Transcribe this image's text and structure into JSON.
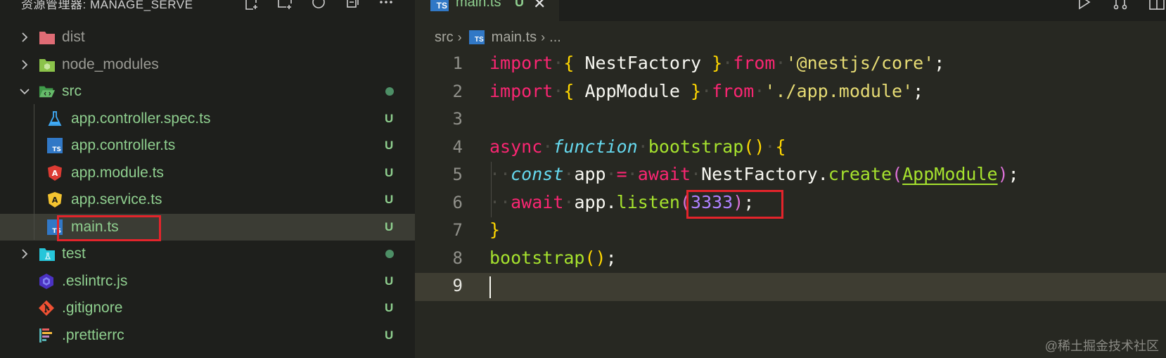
{
  "explorer": {
    "title": "资源管理器: MANAGE_SERVE",
    "actions": [
      "new-file-icon",
      "new-folder-icon",
      "refresh-icon",
      "collapse-all-icon",
      "more-icon"
    ]
  },
  "tree": [
    {
      "name": "dist",
      "type": "folder",
      "expanded": false,
      "color": "#e06c75",
      "label_color": "#9b9b95",
      "status": ""
    },
    {
      "name": "node_modules",
      "type": "folder",
      "expanded": false,
      "color": "#8bc34a",
      "label_color": "#9b9b95",
      "status": ""
    },
    {
      "name": "src",
      "type": "folder",
      "expanded": true,
      "color": "#4caf50",
      "label_color": "#8fcf8f",
      "status": "dot"
    },
    {
      "name": "app.controller.spec.ts",
      "type": "file",
      "icon": "flask-icon",
      "label_color": "#8fcf8f",
      "status": "U"
    },
    {
      "name": "app.controller.ts",
      "type": "file",
      "icon": "typescript-icon",
      "label_color": "#8fcf8f",
      "status": "U"
    },
    {
      "name": "app.module.ts",
      "type": "file",
      "icon": "angular-icon",
      "label_color": "#8fcf8f",
      "status": "U"
    },
    {
      "name": "app.service.ts",
      "type": "file",
      "icon": "angular-service-icon",
      "label_color": "#8fcf8f",
      "status": "U"
    },
    {
      "name": "main.ts",
      "type": "file",
      "icon": "typescript-icon",
      "label_color": "#8fcf8f",
      "status": "U",
      "selected": true
    },
    {
      "name": "test",
      "type": "folder",
      "expanded": false,
      "color": "#26c6da",
      "label_color": "#8fcf8f",
      "status": "dot"
    },
    {
      "name": ".eslintrc.js",
      "type": "file",
      "icon": "eslint-icon",
      "label_color": "#8fcf8f",
      "status": "U"
    },
    {
      "name": ".gitignore",
      "type": "file",
      "icon": "git-icon",
      "label_color": "#8fcf8f",
      "status": "U"
    },
    {
      "name": ".prettierrc",
      "type": "file",
      "icon": "prettier-icon",
      "label_color": "#8fcf8f",
      "status": "U"
    }
  ],
  "tab": {
    "label": "main.ts",
    "status": "U",
    "icon_text": "TS"
  },
  "breadcrumb": {
    "folder": "src",
    "file": "main.ts",
    "more": "..."
  },
  "code": {
    "line_numbers": [
      "1",
      "2",
      "3",
      "4",
      "5",
      "6",
      "7",
      "8",
      "9"
    ],
    "lines": {
      "l1": {
        "kw_import": "import",
        "brace_open": "{",
        "name": " NestFactory ",
        "brace_close": "}",
        "kw_from": "from",
        "path": "'@nestjs/core'",
        "semi": ";"
      },
      "l2": {
        "kw_import": "import",
        "brace_open": "{",
        "name": " AppModule ",
        "brace_close": "}",
        "kw_from": "from",
        "path": "'./app.module'",
        "semi": ";"
      },
      "l4": {
        "kw_async": "async",
        "kw_function": "function",
        "fname": "bootstrap",
        "parens": "()",
        "brace": "{"
      },
      "l5": {
        "kw_const": "const",
        "var": "app",
        "eq": "=",
        "kw_await": "await",
        "obj": "NestFactory",
        "dot": ".",
        "method": "create",
        "po": "(",
        "arg": "AppModule",
        "pc": ")",
        "semi": ";"
      },
      "l6": {
        "kw_await": "await",
        "obj": "app",
        "dot": ".",
        "method": "listen",
        "po": "(",
        "arg": "3333",
        "pc": ")",
        "semi": ";"
      },
      "l7": {
        "brace": "}"
      },
      "l8": {
        "fname": "bootstrap",
        "parens": "()",
        "semi": ";"
      }
    }
  },
  "watermark": "@稀土掘金技术社区",
  "colors": {
    "highlight_box": "#e3242b",
    "git_untracked": "#8fcf8f",
    "ts_blue": "#3178c6"
  }
}
